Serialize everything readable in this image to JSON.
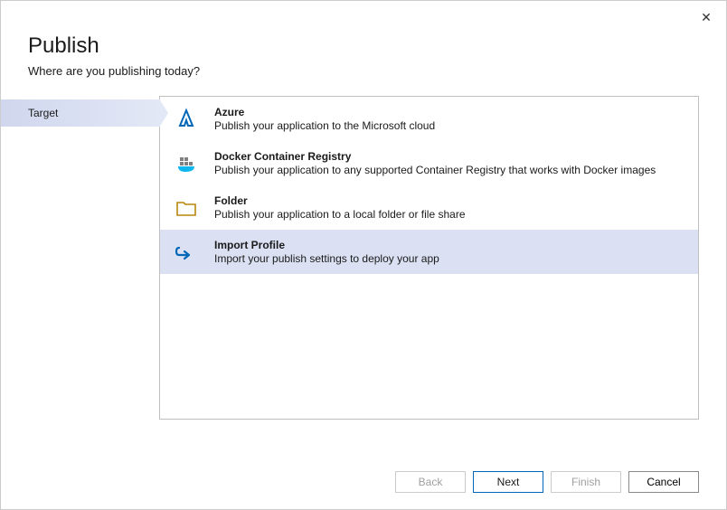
{
  "close_label": "✕",
  "header": {
    "title": "Publish",
    "subtitle": "Where are you publishing today?"
  },
  "sidebar": {
    "items": [
      {
        "label": "Target",
        "active": true
      }
    ]
  },
  "options": [
    {
      "id": "azure",
      "title": "Azure",
      "desc": "Publish your application to the Microsoft cloud",
      "icon": "azure-icon",
      "selected": false
    },
    {
      "id": "docker",
      "title": "Docker Container Registry",
      "desc": "Publish your application to any supported Container Registry that works with Docker images",
      "icon": "docker-icon",
      "selected": false
    },
    {
      "id": "folder",
      "title": "Folder",
      "desc": "Publish your application to a local folder or file share",
      "icon": "folder-icon",
      "selected": false
    },
    {
      "id": "import",
      "title": "Import Profile",
      "desc": "Import your publish settings to deploy your app",
      "icon": "import-icon",
      "selected": true
    }
  ],
  "footer": {
    "back": "Back",
    "next": "Next",
    "finish": "Finish",
    "cancel": "Cancel"
  }
}
